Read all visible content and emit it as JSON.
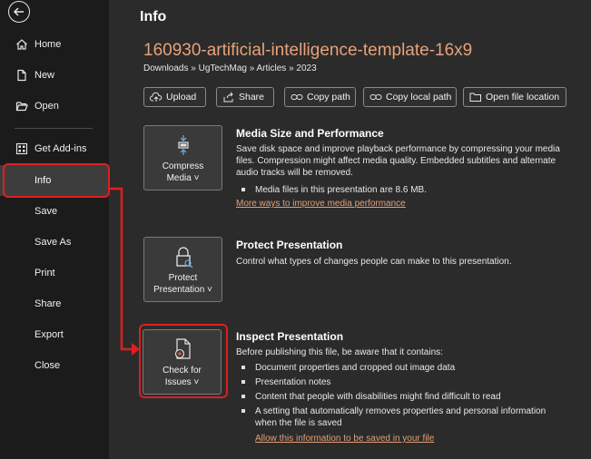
{
  "sidebar": {
    "back_icon": "back-arrow-icon",
    "items": [
      {
        "label": "Home",
        "icon": "home-icon"
      },
      {
        "label": "New",
        "icon": "new-document-icon"
      },
      {
        "label": "Open",
        "icon": "folder-open-icon"
      },
      {
        "label": "Get Add-ins",
        "icon": "add-ins-grid-icon"
      },
      {
        "label": "Info"
      },
      {
        "label": "Save"
      },
      {
        "label": "Save As"
      },
      {
        "label": "Print"
      },
      {
        "label": "Share"
      },
      {
        "label": "Export"
      },
      {
        "label": "Close"
      }
    ],
    "active_item": "Info"
  },
  "main": {
    "page_title": "Info",
    "file_name": "160930-artificial-intelligence-template-16x9",
    "breadcrumb": "Downloads » UgTechMag » Articles » 2023",
    "toolbar": [
      {
        "label": "Upload",
        "icon": "cloud-upload-icon"
      },
      {
        "label": "Share",
        "icon": "share-icon"
      },
      {
        "label": "Copy path",
        "icon": "link-icon"
      },
      {
        "label": "Copy local path",
        "icon": "link-icon"
      },
      {
        "label": "Open file location",
        "icon": "folder-icon"
      }
    ],
    "sections": {
      "media": {
        "button_line1": "Compress",
        "button_line2": "Media ˅",
        "title": "Media Size and Performance",
        "text": "Save disk space and improve playback performance by compressing your media files. Compression might affect media quality. Embedded subtitles and alternate audio tracks will be removed.",
        "bullet": "Media files in this presentation are 8.6 MB.",
        "link": "More ways to improve media performance"
      },
      "protect": {
        "button_line1": "Protect",
        "button_line2": "Presentation ˅",
        "title": "Protect Presentation",
        "text": "Control what types of changes people can make to this presentation."
      },
      "inspect": {
        "button_line1": "Check for",
        "button_line2": "Issues ˅",
        "title": "Inspect Presentation",
        "text": "Before publishing this file, be aware that it contains:",
        "bullets": [
          "Document properties and cropped out image data",
          "Presentation notes",
          "Content that people with disabilities might find difficult to read",
          "A setting that automatically removes properties and personal information when the file is saved"
        ],
        "link": "Allow this information to be saved in your file"
      }
    }
  },
  "colors": {
    "sidebar_bg": "#1b1b1b",
    "main_bg": "#2b2b2b",
    "accent_orange": "#e7a27a",
    "annotation_red": "#e01e1e"
  }
}
